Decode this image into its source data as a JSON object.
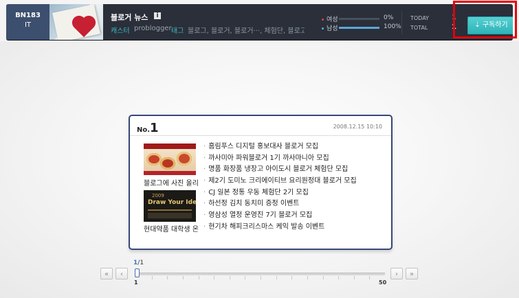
{
  "header": {
    "code": "BN183",
    "category": "IT",
    "blog_name": "블로거 뉴스",
    "info_icon": "i",
    "caster_label": "캐스터",
    "caster_id": "problogger",
    "tags_label": "태그",
    "tags_text": "블로그, 블로거, 블로거···, 체험단, 블로고···",
    "gender": [
      {
        "label": "여성",
        "percent_text": "0%",
        "percent": 0,
        "color": "#e0424a"
      },
      {
        "label": "남성",
        "percent_text": "100%",
        "percent": 100,
        "color": "#5ea8d8"
      }
    ],
    "today_label": "TODAY",
    "total_label": "TOTAL",
    "today_value": "1",
    "total_value": "1",
    "subscribe_label": "⇣ 구독하기"
  },
  "card": {
    "no_prefix": "No.",
    "no_number": "1",
    "date": "2008.12.15 10:10",
    "image_captions": [
      "블로그에 사진 올리",
      "현대약품 대학생 온"
    ],
    "image2_text": {
      "year": "2009",
      "title": "Draw Your Ideal"
    },
    "posts": [
      "홈림푸스 디지털 홍보대사 블로거 모집",
      "까사미아 파워블로거 1기 까사마니아 모집",
      "명품 화장품 냉장고 아이도시 블로거 체험단 모집",
      "제2기 도미노 크리에이티브 요리원정대 블로거 모집",
      "CJ 일본 정통 우동 체험단 2기 모집",
      "하선정 김치 동치미 증정 이벤트",
      "영삼성 열정 운영진 7기 블로거 모집",
      "현기차 해피크리스마스 케익 발송 이벤트"
    ]
  },
  "pager": {
    "current": "1",
    "separator": "/",
    "total": "1",
    "first_label": "«",
    "prev_label": "‹",
    "next_label": "›",
    "last_label": "»",
    "min_label": "1",
    "max_label": "50",
    "slider_position": 1
  },
  "colors": {
    "header_bg": "#2a2f3a",
    "code_bg": "#3d4f6e",
    "accent_teal": "#3db9c0",
    "card_border": "#36477a",
    "highlight_red": "#e5000a"
  }
}
